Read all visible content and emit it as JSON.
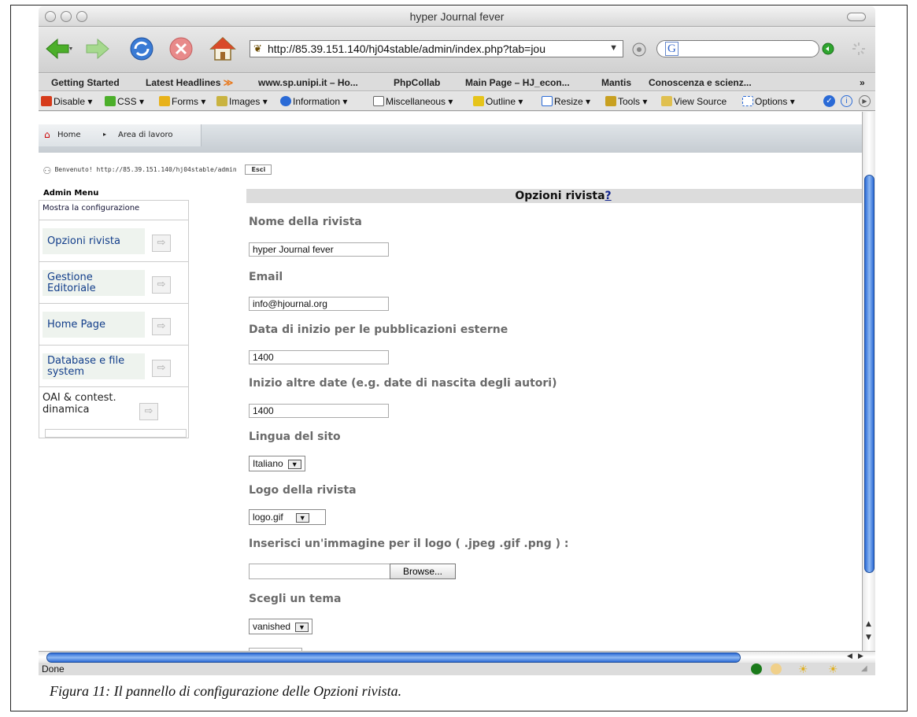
{
  "window": {
    "title": "hyper Journal fever"
  },
  "navigation": {
    "url": "http://85.39.151.140/hj04stable/admin/index.php?tab=jou",
    "search_engine_label": "G"
  },
  "bookmarks": [
    "Getting Started",
    "Latest Headlines",
    "www.sp.unipi.it – Ho...",
    "PhpCollab",
    "Main Page – HJ_econ...",
    "Mantis",
    "Conoscenza e scienz...",
    "»"
  ],
  "devtools": [
    "Disable",
    "CSS",
    "Forms",
    "Images",
    "Information",
    "Miscellaneous",
    "Outline",
    "Resize",
    "Tools",
    "View Source",
    "Options"
  ],
  "breadcrumb": {
    "home": "Home",
    "area": "Area di lavoro"
  },
  "welcome": {
    "text": "Benvenuto! http://85.39.151.140/hj04stable/admin",
    "logout": "Esci"
  },
  "admin_menu": {
    "title": "Admin Menu",
    "config_link": "Mostra la configurazione",
    "items": [
      "Opzioni rivista",
      "Gestione Editoriale",
      "Home Page",
      "Database e file system",
      "OAI & contest. dinamica"
    ]
  },
  "form": {
    "title": "Opzioni rivista",
    "help": "?",
    "fields": [
      {
        "label": "Nome della rivista",
        "value": "hyper Journal fever"
      },
      {
        "label": "Email",
        "value": "info@hjournal.org"
      },
      {
        "label": "Data di inizio per le pubblicazioni esterne",
        "value": "1400"
      },
      {
        "label": "Inizio altre date (e.g. date di nascita degli autori)",
        "value": "1400"
      },
      {
        "label": "Lingua del sito",
        "value": "Italiano"
      },
      {
        "label": "Logo della rivista",
        "value": "logo.gif"
      },
      {
        "label": "Inserisci un'immagine per il logo ( .jpeg .gif .png ) :",
        "value": "",
        "button": "Browse..."
      },
      {
        "label": "Scegli un tema",
        "value": "vanished"
      }
    ]
  },
  "status": {
    "text": "Done"
  },
  "caption": "Figura 11: Il pannello di configurazione delle Opzioni rivista."
}
